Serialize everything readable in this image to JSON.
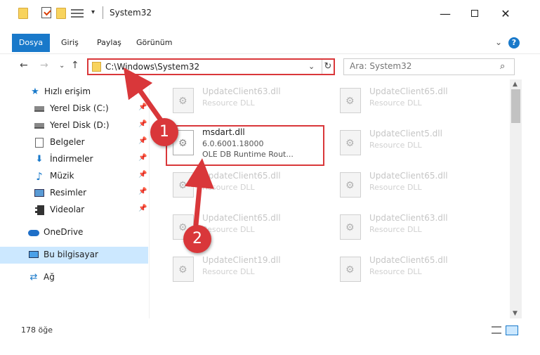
{
  "window": {
    "title": "System32",
    "controls": {
      "minimize": "—",
      "close": "✕"
    }
  },
  "quick_access_toolbar": {
    "dropdown": "▾"
  },
  "ribbon": {
    "tabs": [
      {
        "label": "Dosya",
        "active": true
      },
      {
        "label": "Giriş"
      },
      {
        "label": "Paylaş"
      },
      {
        "label": "Görünüm"
      }
    ],
    "expand_icon": "⌄",
    "help": "?"
  },
  "navigation": {
    "back": "←",
    "forward": "→",
    "recent": "⌄",
    "up": "↑",
    "address": "C:\\Windows\\System32",
    "address_dropdown": "⌄",
    "refresh": "↻",
    "search_placeholder": "Ara: System32",
    "search_icon": "⌕"
  },
  "sidebar": {
    "items": [
      {
        "label": "Hızlı erişim",
        "icon": "star-icon",
        "pinned": false
      },
      {
        "label": "Yerel Disk (C:)",
        "icon": "drive-icon",
        "pinned": true
      },
      {
        "label": "Yerel Disk (D:)",
        "icon": "drive-icon",
        "pinned": true
      },
      {
        "label": "Belgeler",
        "icon": "document-icon",
        "pinned": true
      },
      {
        "label": "İndirmeler",
        "icon": "download-icon",
        "pinned": true
      },
      {
        "label": "Müzik",
        "icon": "music-icon",
        "pinned": true
      },
      {
        "label": "Resimler",
        "icon": "pictures-icon",
        "pinned": true
      },
      {
        "label": "Videolar",
        "icon": "video-icon",
        "pinned": true
      },
      {
        "label": "OneDrive",
        "icon": "cloud-icon",
        "pinned": false
      },
      {
        "label": "Bu bilgisayar",
        "icon": "computer-icon",
        "pinned": false,
        "selected": true
      },
      {
        "label": "Ağ",
        "icon": "network-icon",
        "pinned": false
      }
    ],
    "pin_glyph": "📌",
    "star_glyph": "★",
    "download_glyph": "⬇",
    "music_glyph": "♪",
    "network_glyph": "⇄"
  },
  "files": {
    "highlighted": {
      "name": "msdart.dll",
      "version": "6.0.6001.18000",
      "description": "OLE DB Runtime Rout..."
    },
    "left_column": [
      {
        "name": "UpdateClient63.dll",
        "type": "Resource DLL"
      },
      {
        "name": "UpdateClient65.dll",
        "type": "Resource DLL"
      },
      {
        "name": "UpdateClient65.dll",
        "type": "Resource DLL"
      },
      {
        "name": "UpdateClient19.dll",
        "type": "Resource DLL"
      }
    ],
    "right_column": [
      {
        "name": "UpdateClient65.dll",
        "type": "Resource DLL"
      },
      {
        "name": "UpdateClient5.dll",
        "type": "Resource DLL"
      },
      {
        "name": "UpdateClient65.dll",
        "type": "Resource DLL"
      },
      {
        "name": "UpdateClient63.dll",
        "type": "Resource DLL"
      },
      {
        "name": "UpdateClient65.dll",
        "type": "Resource DLL"
      }
    ]
  },
  "status": {
    "item_count": "178 öğe"
  },
  "annotations": {
    "step1": "1",
    "step2": "2",
    "color": "#d9373a"
  },
  "colors": {
    "accent": "#1979ca",
    "selection": "#cce8ff",
    "highlight": "#d9373a"
  }
}
